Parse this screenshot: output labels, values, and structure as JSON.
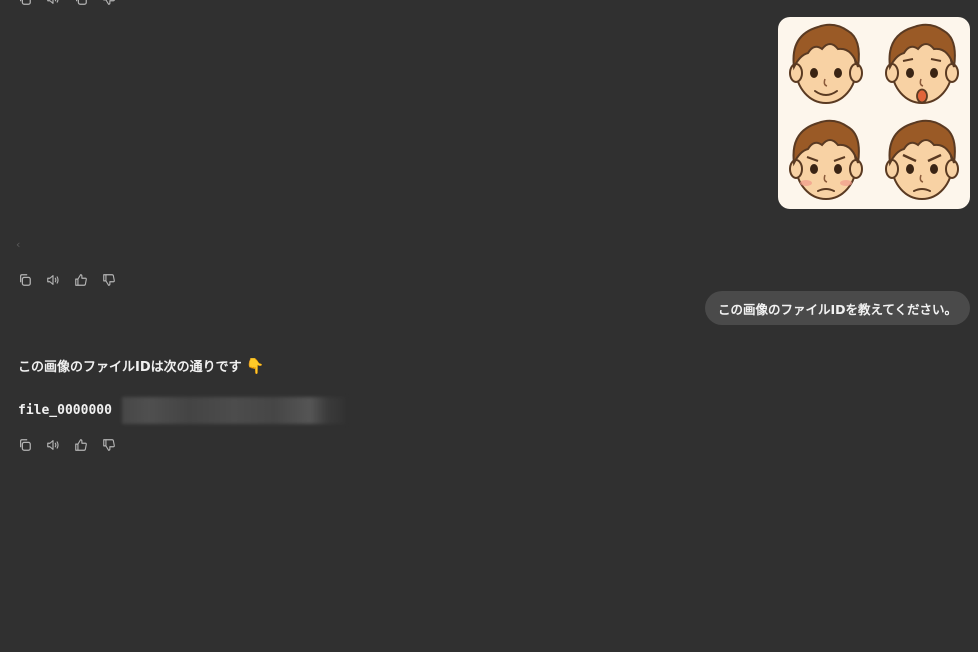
{
  "toolbar": {
    "copy": "copy-icon",
    "read_aloud": "speaker-icon",
    "good_response": "thumbs-up-icon",
    "bad_response": "thumbs-down-icon"
  },
  "user_message": {
    "image": "four-faces-expressions-image",
    "text": "この画像のファイルIDを教えてください。"
  },
  "assistant_message": {
    "intro": "この画像のファイルIDは次の通りです",
    "intro_emoji": "👇",
    "file_id_visible": "file_0000000",
    "file_id_redacted": true
  },
  "colors": {
    "background": "#303030",
    "bubble": "#4a4a4a",
    "text": "#ececec",
    "icon": "#b4b4b4"
  }
}
